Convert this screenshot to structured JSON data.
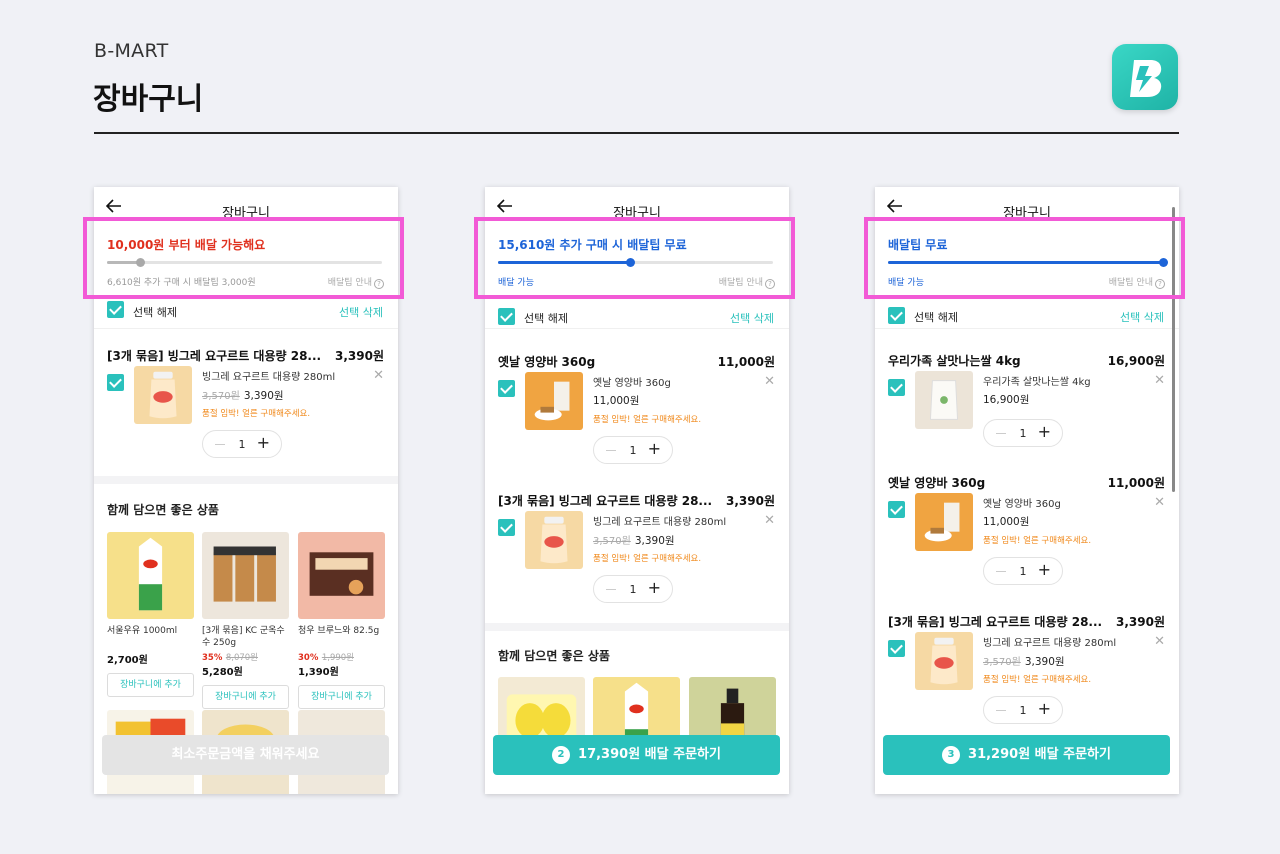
{
  "header": {
    "brand": "B-MART",
    "title": "장바구니"
  },
  "colors": {
    "accent": "#2ac1bc",
    "warning_red": "#e0301e",
    "info_blue": "#1d64d8",
    "highlight": "#f25ad6"
  },
  "screens": [
    {
      "topbar_title": "장바구니",
      "banner": {
        "message": "10,000원 부터 배달 가능해요",
        "progress": 0.12,
        "sub": "6,610원 추가 구매 시 배달팁 3,000원",
        "help": "배달팁 안내"
      },
      "select_label": "선택 해제",
      "select_delete": "선택 삭제",
      "items": [
        {
          "title": "[3개 묶음] 빙그레 요구르트 대용량 28...",
          "total": "3,390원",
          "name": "빙그레 요구르트 대용량 280ml",
          "orig_price": "3,570원",
          "price": "3,390원",
          "warn": "품절 임박! 얼른 구매해주세요.",
          "qty": "1",
          "image": "yogurt"
        }
      ],
      "rec_title": "함께 담으면 좋은 상품",
      "recs": [
        {
          "name": "서울우유 1000ml",
          "price": "2,700원",
          "discount": "",
          "orig": "",
          "button": "장바구니에 추가"
        },
        {
          "name": "[3개 묶음] KC 군옥수수 250g",
          "price": "5,280원",
          "discount": "35%",
          "orig": "8,070원",
          "button": "장바구니에 추가"
        },
        {
          "name": "청우 브루느와 82.5g",
          "price": "1,390원",
          "discount": "30%",
          "orig": "1,990원",
          "button": "장바구니에 추가"
        }
      ],
      "cta": {
        "count": "",
        "label": "최소주문금액을 채워주세요"
      }
    },
    {
      "topbar_title": "장바구니",
      "banner": {
        "message": "15,610원 추가 구매 시 배달팁 무료",
        "progress": 0.48,
        "sub": "배달 가능",
        "help": "배달팁 안내"
      },
      "select_label": "선택 해제",
      "select_delete": "선택 삭제",
      "items": [
        {
          "title": "옛날 영양바 360g",
          "total": "11,000원",
          "name": "옛날 영양바 360g",
          "orig_price": "",
          "price": "11,000원",
          "warn": "품절 임박! 얼른 구매해주세요.",
          "qty": "1",
          "image": "bar"
        },
        {
          "title": "[3개 묶음] 빙그레 요구르트 대용량 28...",
          "total": "3,390원",
          "name": "빙그레 요구르트 대용량 280ml",
          "orig_price": "3,570원",
          "price": "3,390원",
          "warn": "품절 임박! 얼른 구매해주세요.",
          "qty": "1",
          "image": "yogurt"
        }
      ],
      "rec_title": "함께 담으면 좋은 상품",
      "cta": {
        "count": "2",
        "label": "17,390원 배달 주문하기"
      }
    },
    {
      "topbar_title": "장바구니",
      "banner": {
        "message": "배달팁 무료",
        "progress": 1.0,
        "sub": "배달 가능",
        "help": "배달팁 안내"
      },
      "select_label": "선택 해제",
      "select_delete": "선택 삭제",
      "items": [
        {
          "title": "우리가족 살맛나는쌀 4kg",
          "total": "16,900원",
          "name": "우리가족 살맛나는쌀 4kg",
          "orig_price": "",
          "price": "16,900원",
          "warn": "",
          "qty": "1",
          "image": "rice"
        },
        {
          "title": "옛날 영양바 360g",
          "total": "11,000원",
          "name": "옛날 영양바 360g",
          "orig_price": "",
          "price": "11,000원",
          "warn": "품절 임박! 얼른 구매해주세요.",
          "qty": "1",
          "image": "bar"
        },
        {
          "title": "[3개 묶음] 빙그레 요구르트 대용량 28...",
          "total": "3,390원",
          "name": "빙그레 요구르트 대용량 280ml",
          "orig_price": "3,570원",
          "price": "3,390원",
          "warn": "품절 임박! 얼른 구매해주세요.",
          "qty": "1",
          "image": "yogurt"
        }
      ],
      "cta": {
        "count": "3",
        "label": "31,290원 배달 주문하기"
      }
    }
  ]
}
